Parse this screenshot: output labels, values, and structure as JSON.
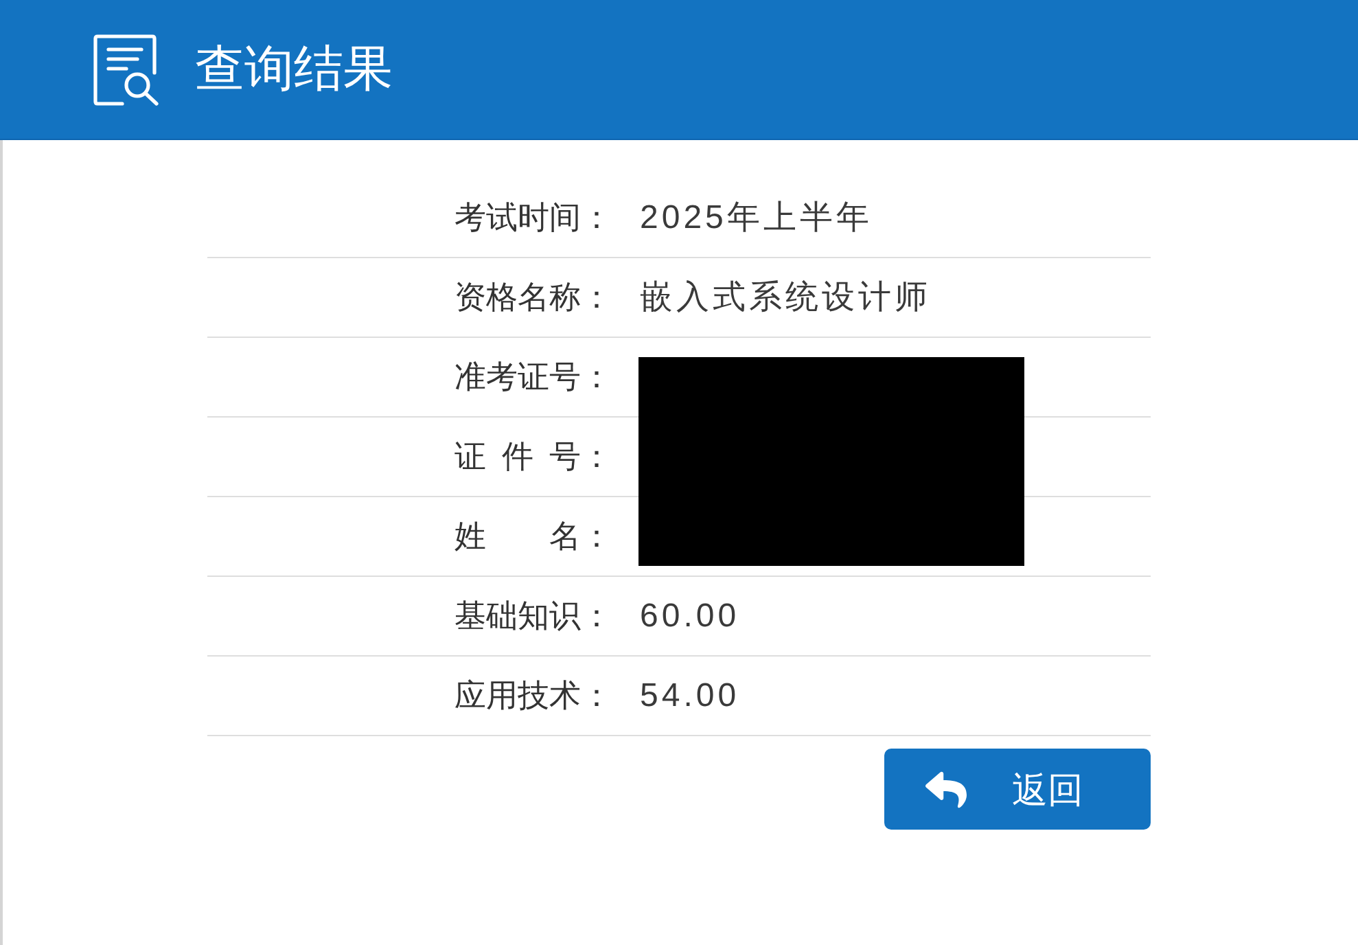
{
  "header": {
    "title": "查询结果"
  },
  "result_rows": [
    {
      "label": "考试时间：",
      "value": "2025年上半年",
      "redacted": false
    },
    {
      "label": "资格名称：",
      "value": "嵌入式系统设计师",
      "redacted": false
    },
    {
      "label": "准考证号：",
      "redacted": true
    },
    {
      "label": "证 件 号：",
      "redacted": true
    },
    {
      "label": "姓　　名：",
      "redacted": true
    },
    {
      "label": "基础知识：",
      "value": "60.00",
      "redacted": false
    },
    {
      "label": "应用技术：",
      "value": "54.00",
      "redacted": false
    }
  ],
  "back_button": {
    "label": "返回"
  }
}
